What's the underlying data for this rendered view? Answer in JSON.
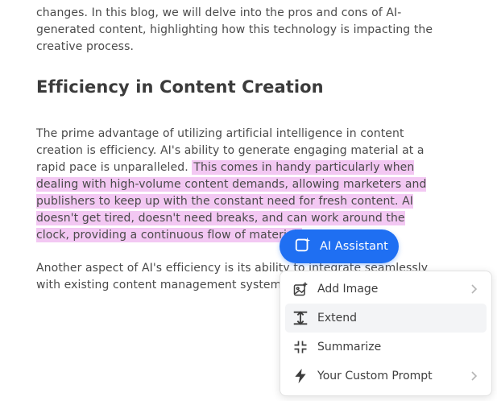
{
  "article": {
    "intro": "changes. In this blog, we will delve into the pros and cons of AI-generated content, highlighting how this technology is impacting the creative process.",
    "heading": "Efficiency in Content Creation",
    "paragraph1_plain": "The prime advantage of utilizing artificial intelligence in content creation is efficiency. AI's ability to generate engaging material at a rapid pace is unparalleled. ",
    "paragraph1_highlighted": "This comes in handy particularly when dealing with high-volume content demands, allowing marketers and publishers to keep up with the constant need for fresh content. AI doesn't get tired, doesn't need breaks, and can work around the clock, providing a continuous flow of material.",
    "paragraph2": "Another aspect of AI's efficiency is its ability to integrate seamlessly with existing content management systems"
  },
  "ai_button": {
    "label": "AI Assistant",
    "icon": "ai-sparkle-icon",
    "color": "#1f6ff2"
  },
  "menu": {
    "items": [
      {
        "label": "Add Image",
        "icon": "image-add-icon",
        "has_submenu": true
      },
      {
        "label": "Extend",
        "icon": "extend-icon",
        "has_submenu": false,
        "active": true
      },
      {
        "label": "Summarize",
        "icon": "collapse-icon",
        "has_submenu": false
      },
      {
        "label": "Your Custom Prompt",
        "icon": "lightning-icon",
        "has_submenu": true
      }
    ]
  },
  "colors": {
    "highlight": "#f3c8f3",
    "text": "#4a4a4a",
    "heading": "#3b3b3b"
  }
}
